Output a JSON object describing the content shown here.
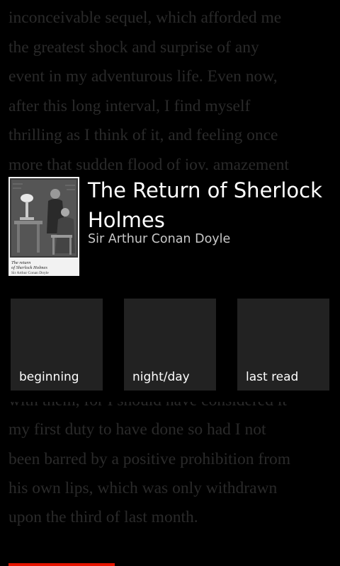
{
  "reader": {
    "lines": [
      "inconceivable sequel, which afforded me",
      "the greatest shock and surprise of any",
      "event in my adventurous life. Even now,",
      "after this long interval, I find myself",
      "thrilling as I think of it, and feeling once",
      "more that sudden flood of joy, amazement",
      "with them, for I should have considered it",
      "my first duty to have done so had I not",
      "been barred by a positive prohibition from",
      "his own lips, which was only withdrawn",
      "upon the third of last month."
    ]
  },
  "book": {
    "title": "The Return of Sherlock Holmes",
    "author": "Sir Arthur Conan Doyle",
    "cover_text": {
      "line1": "The return",
      "line2": "of Sherlock Holmes",
      "line3": "Sir Arthur Conan Doyle"
    }
  },
  "actions": {
    "beginning": "beginning",
    "night_day": "night/day",
    "last_read": "last read"
  },
  "progress": {
    "fraction": 0.32,
    "color": "#e51400"
  }
}
